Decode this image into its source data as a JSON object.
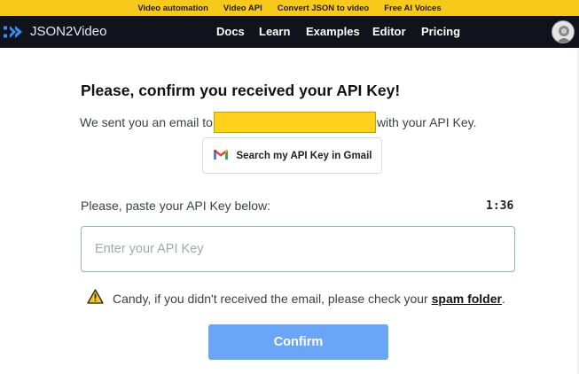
{
  "promo_bar": {
    "links": [
      "Video automation",
      "Video API",
      "Convert JSON to video",
      "Free AI Voices"
    ],
    "background": "#f7c91b"
  },
  "navbar": {
    "brand": "JSON2Video",
    "links": [
      "Docs",
      "Learn",
      "Examples",
      "Editor",
      "Pricing"
    ],
    "background": "#10131c",
    "logo_icon": "play-chevrons-icon",
    "avatar_icon": "user-avatar"
  },
  "main": {
    "title": "Please, confirm you received your API Key!",
    "sent_before": "We sent you an email to",
    "sent_after": "with your API Key.",
    "gmail_button": "Search my API Key in Gmail",
    "gmail_icon": "gmail-icon",
    "paste_label": "Please, paste your API Key below:",
    "timer": "1:36",
    "api_input_placeholder": "Enter your API Key",
    "api_input_value": "",
    "warning_icon": "warning-triangle-icon",
    "warning_prefix": "Candy, if you didn't received the email, please check your",
    "spam_link": "spam folder",
    "warning_suffix": ".",
    "confirm_button": "Confirm",
    "accent": "#6aa6f8",
    "redaction_color": "#ffd11a"
  }
}
